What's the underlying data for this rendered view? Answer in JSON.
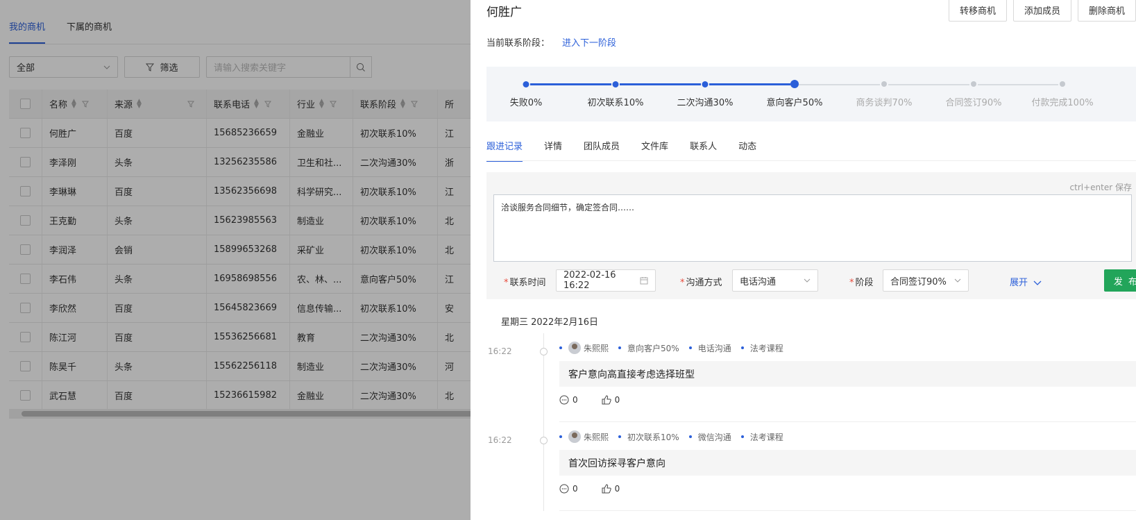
{
  "list": {
    "tabs": [
      {
        "label": "我的商机",
        "active": true
      },
      {
        "label": "下属的商机",
        "active": false
      }
    ],
    "filter_select": "全部",
    "filter_button": "筛选",
    "search_placeholder": "请输入搜索关键字",
    "columns": [
      "名称",
      "来源",
      "联系电话",
      "行业",
      "联系阶段",
      "所"
    ],
    "rows": [
      [
        "何胜广",
        "百度",
        "15685236659",
        "金融业",
        "初次联系10%",
        "江"
      ],
      [
        "李泽刚",
        "头条",
        "13256235586",
        "卫生和社...",
        "二次沟通30%",
        "浙"
      ],
      [
        "李琳琳",
        "百度",
        "13562356698",
        "科学研究...",
        "初次联系10%",
        "江"
      ],
      [
        "王克勤",
        "头条",
        "15623985563",
        "制造业",
        "初次联系10%",
        "北"
      ],
      [
        "李润泽",
        "会销",
        "15899653268",
        "采矿业",
        "初次联系10%",
        "北"
      ],
      [
        "李石伟",
        "头条",
        "16958698556",
        "农、林、...",
        "意向客户50%",
        "江"
      ],
      [
        "李欣然",
        "百度",
        "15645823669",
        "信息传输...",
        "初次联系10%",
        "安"
      ],
      [
        "陈江河",
        "百度",
        "15536256681",
        "教育",
        "二次沟通30%",
        "北"
      ],
      [
        "陈昊千",
        "头条",
        "15562256118",
        "制造业",
        "二次沟通30%",
        "河"
      ],
      [
        "武石慧",
        "百度",
        "15236615982",
        "金融业",
        "二次沟通30%",
        "北"
      ]
    ]
  },
  "drawer": {
    "title": "何胜广",
    "buttons": [
      "转移商机",
      "添加成员",
      "删除商机"
    ],
    "stage_label": "当前联系阶段：",
    "next_stage": "进入下一阶段",
    "steps": [
      {
        "label": "失败0%",
        "done": true
      },
      {
        "label": "初次联系10%",
        "done": true
      },
      {
        "label": "二次沟通30%",
        "done": true
      },
      {
        "label": "意向客户50%",
        "done": true,
        "current": true
      },
      {
        "label": "商务谈判70%",
        "done": false
      },
      {
        "label": "合同签订90%",
        "done": false
      },
      {
        "label": "付款完成100%",
        "done": false
      }
    ],
    "tabs": [
      "跟进记录",
      "详情",
      "团队成员",
      "文件库",
      "联系人",
      "动态"
    ],
    "hint": "ctrl+enter 保存",
    "textarea_value": "洽谈服务合同细节，确定签合同……",
    "form": {
      "time_label": "联系时间",
      "time_value": "2022-02-16 16:22",
      "method_label": "沟通方式",
      "method_value": "电话沟通",
      "stage_label": "阶段",
      "stage_value": "合同签订90%",
      "expand": "展开",
      "publish": "发 布"
    },
    "day_title": "星期三 2022年2月16日",
    "records": [
      {
        "time": "16:22",
        "user": "朱熙熙",
        "stage": "意向客户50%",
        "method": "电话沟通",
        "course": "法考课程",
        "content": "客户意向高直接考虑选择班型",
        "comments": "0",
        "likes": "0"
      },
      {
        "time": "16:22",
        "user": "朱熙熙",
        "stage": "初次联系10%",
        "method": "微信沟通",
        "course": "法考课程",
        "content": "首次回访探寻客户意向",
        "comments": "0",
        "likes": "0"
      }
    ]
  },
  "colors": {
    "accent": "#2b5fd9",
    "publish": "#22a55a",
    "required": "#e84c3d"
  }
}
